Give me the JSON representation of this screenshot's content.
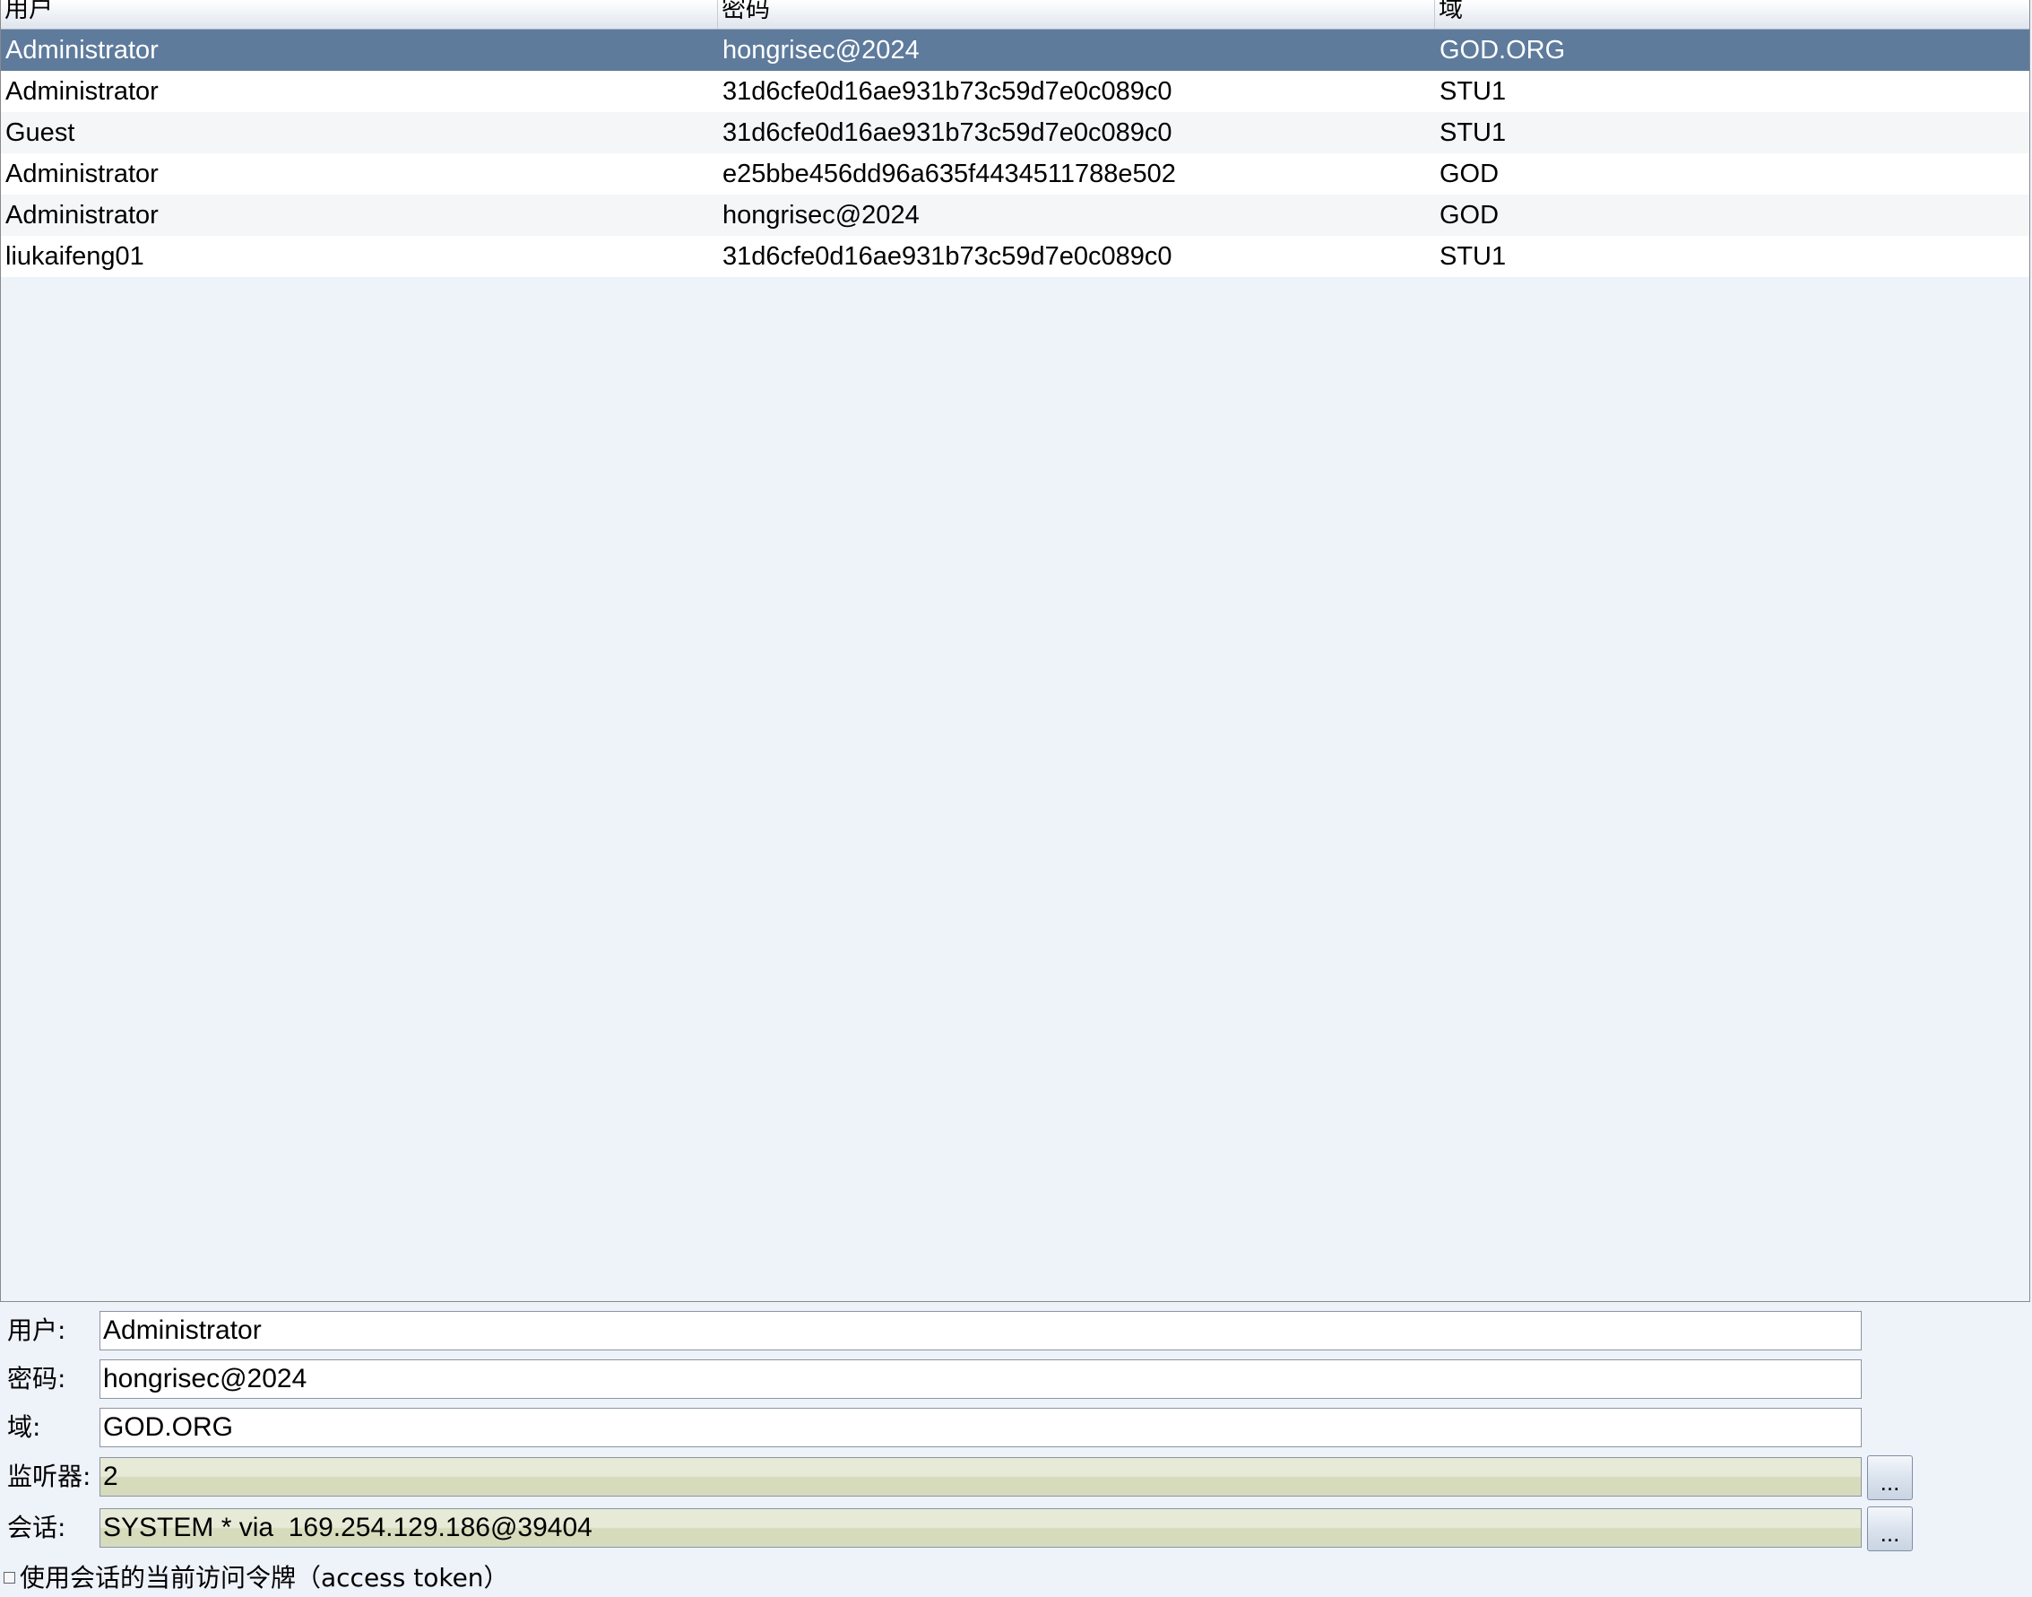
{
  "table": {
    "columns": [
      "用户",
      "密码",
      "域"
    ],
    "rows": [
      {
        "user": "Administrator",
        "password": "hongrisec@2024",
        "domain": "GOD.ORG",
        "selected": true
      },
      {
        "user": "Administrator",
        "password": "31d6cfe0d16ae931b73c59d7e0c089c0",
        "domain": "STU1",
        "selected": false
      },
      {
        "user": "Guest",
        "password": "31d6cfe0d16ae931b73c59d7e0c089c0",
        "domain": "STU1",
        "selected": false
      },
      {
        "user": "Administrator",
        "password": "e25bbe456dd96a635f4434511788e502",
        "domain": "GOD",
        "selected": false
      },
      {
        "user": "Administrator",
        "password": "hongrisec@2024",
        "domain": "GOD",
        "selected": false
      },
      {
        "user": "liukaifeng01",
        "password": "31d6cfe0d16ae931b73c59d7e0c089c0",
        "domain": "STU1",
        "selected": false
      }
    ]
  },
  "form": {
    "user_label": "用户:",
    "user_value": "Administrator",
    "password_label": "密码:",
    "password_value": "hongrisec@2024",
    "domain_label": "域:",
    "domain_value": "GOD.ORG",
    "listener_label": "监听器:",
    "listener_value": "2",
    "listener_button": "...",
    "session_label": "会话:",
    "session_value": "SYSTEM * via  169.254.129.186@39404",
    "session_button": "...",
    "token_checkbox_checked": false,
    "token_label": "使用会话的当前访问令牌（access token）"
  },
  "colors": {
    "selected_row": "#5e7b9c",
    "panel_background": "#eef2f9",
    "readonly_field": "#dfe3c8"
  }
}
